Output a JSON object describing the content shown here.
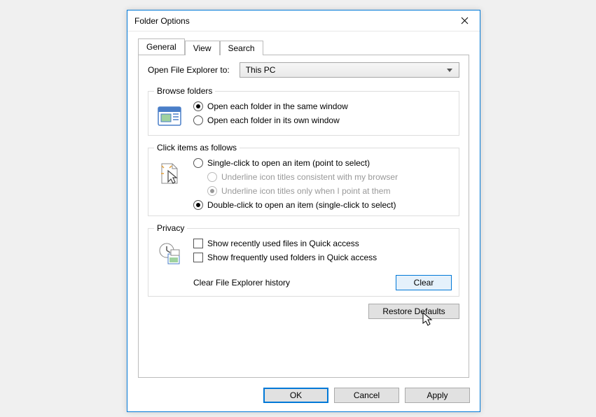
{
  "window": {
    "title": "Folder Options"
  },
  "tabs": {
    "general": "General",
    "view": "View",
    "search": "Search"
  },
  "openExplorer": {
    "label": "Open File Explorer to:",
    "value": "This PC"
  },
  "browseFolders": {
    "legend": "Browse folders",
    "sameWindow": "Open each folder in the same window",
    "ownWindow": "Open each folder in its own window"
  },
  "clickItems": {
    "legend": "Click items as follows",
    "single": "Single-click to open an item (point to select)",
    "underlineBrowser": "Underline icon titles consistent with my browser",
    "underlinePoint": "Underline icon titles only when I point at them",
    "double": "Double-click to open an item (single-click to select)"
  },
  "privacy": {
    "legend": "Privacy",
    "showFiles": "Show recently used files in Quick access",
    "showFolders": "Show frequently used folders in Quick access",
    "clearLabel": "Clear File Explorer history",
    "clearBtn": "Clear"
  },
  "buttons": {
    "restoreDefaults": "Restore Defaults",
    "ok": "OK",
    "cancel": "Cancel",
    "apply": "Apply"
  }
}
